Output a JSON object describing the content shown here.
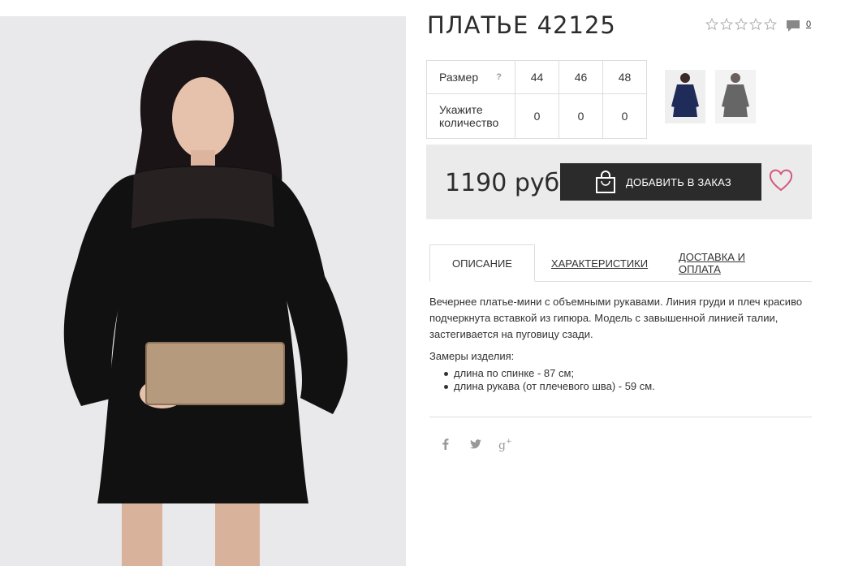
{
  "product": {
    "title": "ПЛАТЬЕ 42125",
    "comment_count": "0",
    "rating_stars": 0
  },
  "sizes": {
    "row1_label": "Размер",
    "help_glyph": "?",
    "row2_label": "Укажите количество",
    "columns": [
      {
        "size": "44",
        "qty": "0"
      },
      {
        "size": "46",
        "qty": "0"
      },
      {
        "size": "48",
        "qty": "0"
      }
    ]
  },
  "purchase": {
    "price": "1190 руб",
    "add_to_order": "ДОБАВИТЬ В ЗАКАЗ"
  },
  "tabs": {
    "description": "ОПИСАНИЕ",
    "characteristics": "ХАРАКТЕРИСТИКИ",
    "delivery": "ДОСТАВКА И ОПЛАТА"
  },
  "description": {
    "text": "Вечернее платье-мини с объемными рукавами. Линия груди и плеч красиво подчеркнута вставкой из гипюра. Модель с завышенной линией талии, застегивается на пуговицу сзади.",
    "measures_title": "Замеры изделия:",
    "measures": [
      "длина по спинке - 87 см;",
      "длина рукава (от плечевого шва) - 59 см."
    ]
  },
  "icons": {
    "stars": "star-outline-icon",
    "comment": "speech-bubble-icon",
    "bag": "shopping-bag-icon",
    "heart": "heart-outline-icon",
    "social": [
      "facebook-icon",
      "twitter-icon",
      "google-plus-icon"
    ]
  },
  "colors": {
    "button_bg": "#2b2b2b",
    "price_box_bg": "#ebebeb",
    "heart": "#d4577c"
  }
}
